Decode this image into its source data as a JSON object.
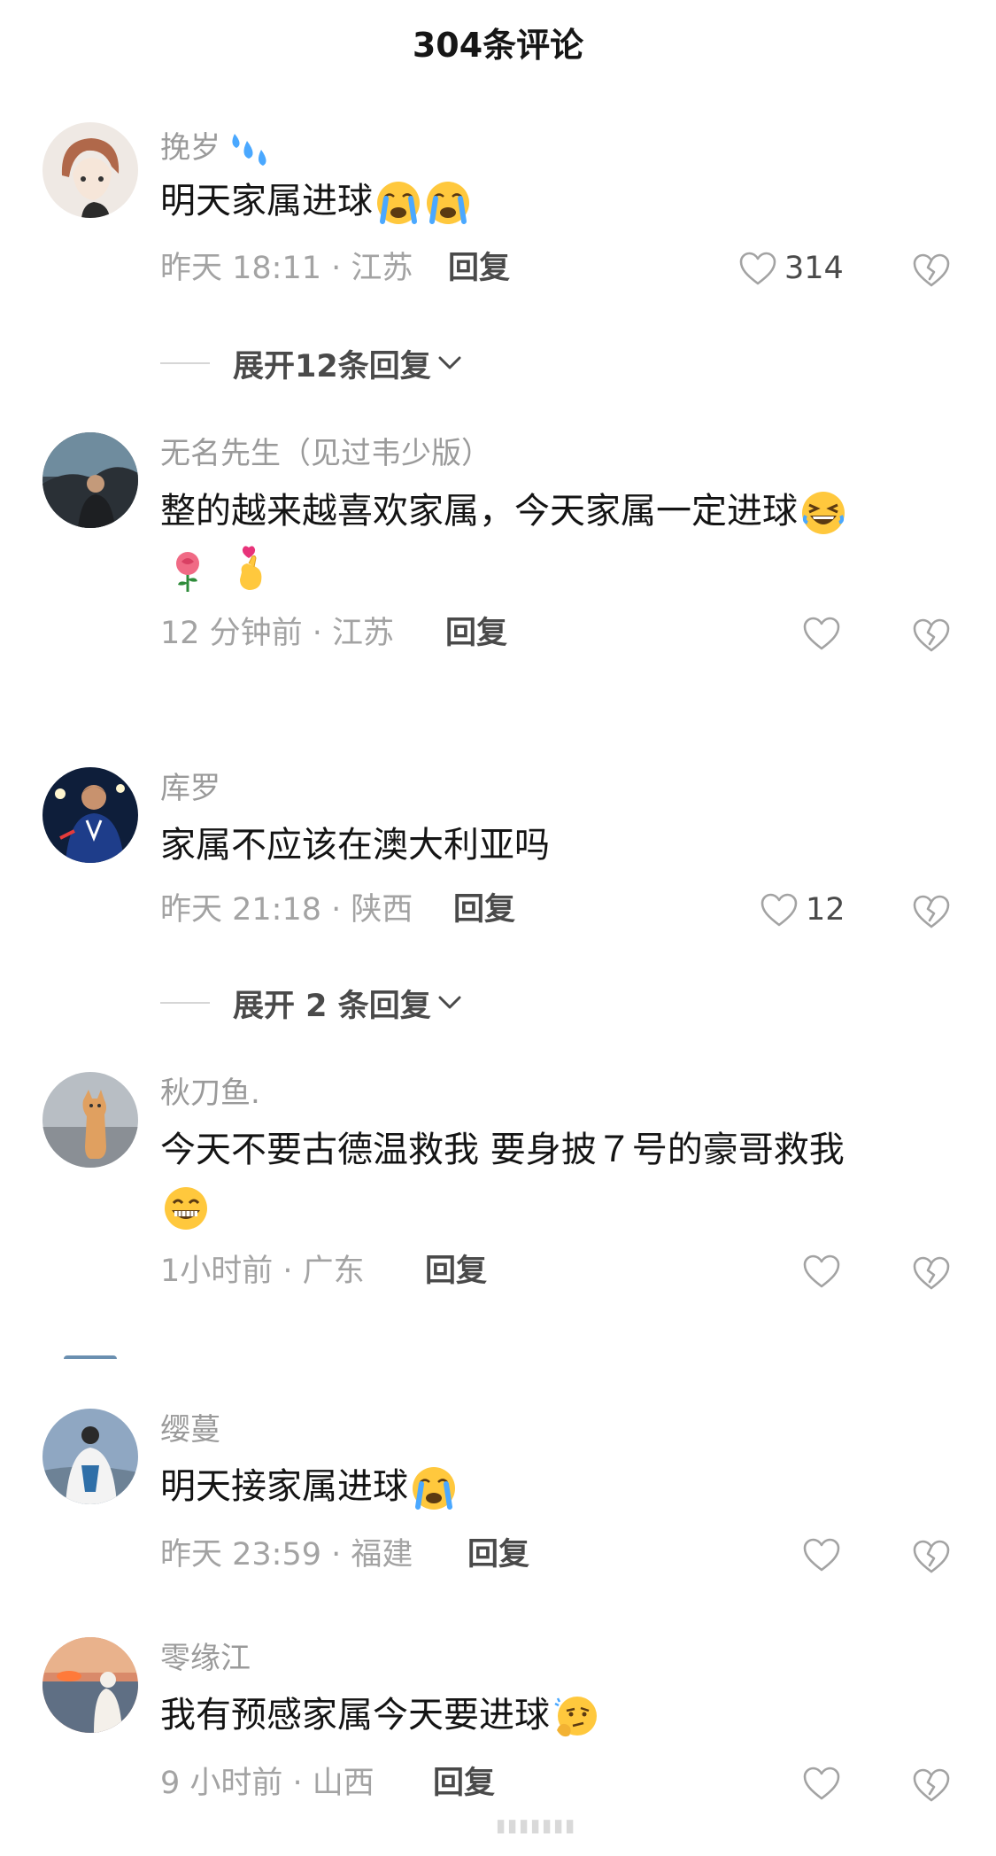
{
  "header": {
    "title": "304条评论"
  },
  "comments": [
    {
      "username": "挽岁",
      "text": "明天家属进球",
      "meta": "昨天 18:11 · 江苏",
      "reply": "回复",
      "likes": "314",
      "expand": "展开12条回复"
    },
    {
      "username": "无名先生（见过韦少版）",
      "text": "整的越来越喜欢家属，今天家属一定进球",
      "meta": "12 分钟前 · 江苏",
      "reply": "回复",
      "likes": ""
    },
    {
      "username": "库罗",
      "text": "家属不应该在澳大利亚吗",
      "meta": "昨天 21:18 · 陕西",
      "reply": "回复",
      "likes": "12",
      "expand": "展开 2 条回复"
    },
    {
      "username": "秋刀鱼.",
      "text": "今天不要古德温救我 要身披７号的豪哥救我",
      "meta": "1小时前 · 广东",
      "reply": "回复",
      "likes": ""
    },
    {
      "username": "缨蔓",
      "text": "明天接家属进球",
      "meta": "昨天 23:59 · 福建",
      "reply": "回复",
      "likes": ""
    },
    {
      "username": "零缘江",
      "text": "我有预感家属今天要进球",
      "meta": "9 小时前 · 山西",
      "reply": "回复",
      "likes": ""
    }
  ],
  "icons": {
    "like": "heart-outline-icon",
    "dislike": "broken-heart-icon",
    "chevron": "chevron-down-icon"
  },
  "colors": {
    "text_primary": "#141414",
    "text_secondary": "#a3a3a3",
    "action": "#4a4a4a"
  }
}
